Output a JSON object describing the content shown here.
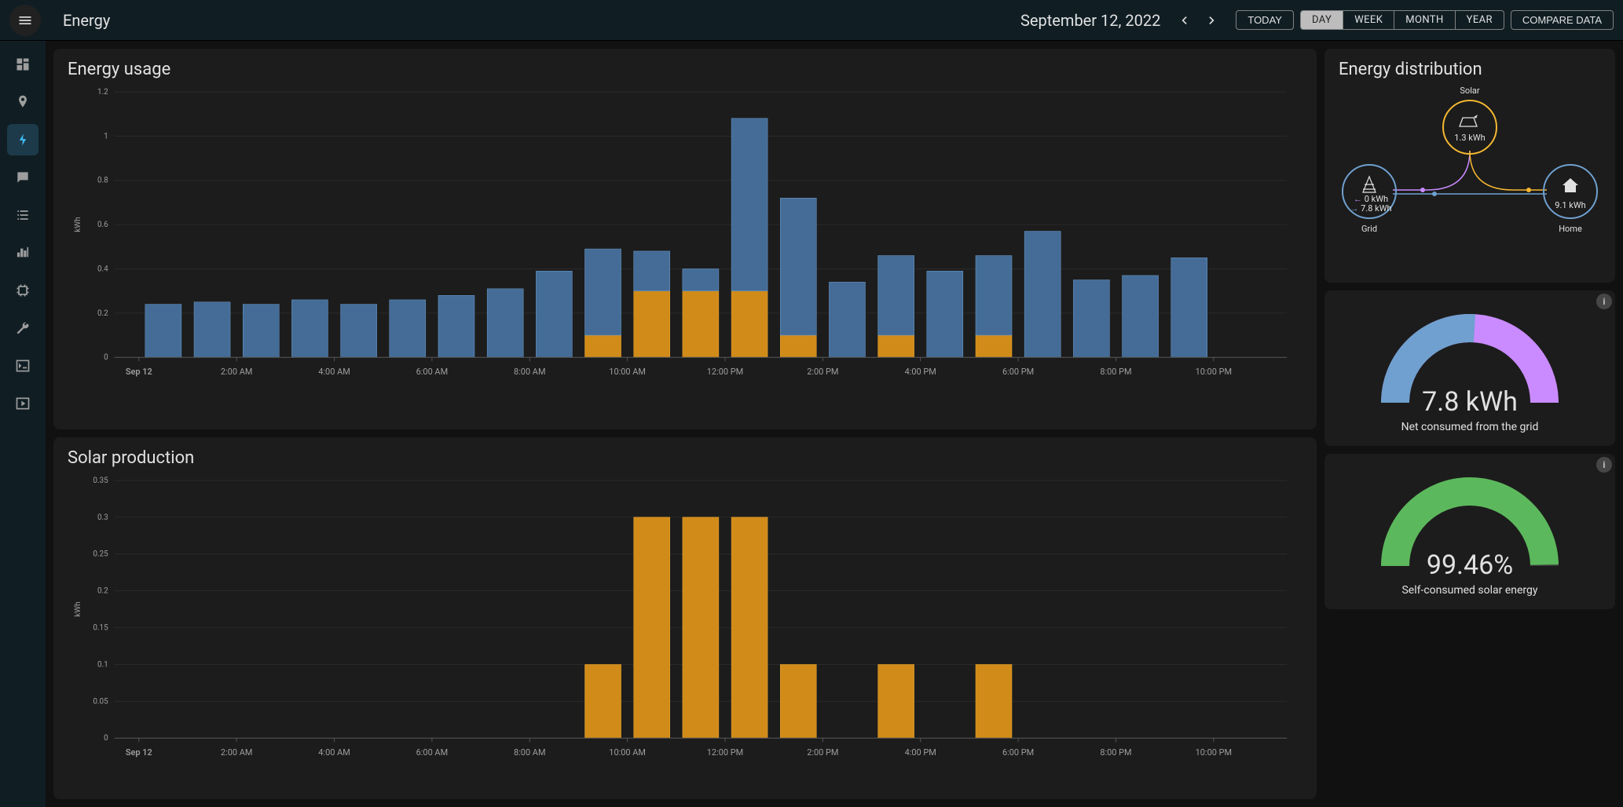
{
  "header": {
    "title": "Energy",
    "date": "September 12, 2022",
    "today_label": "TODAY",
    "ranges": [
      "DAY",
      "WEEK",
      "MONTH",
      "YEAR"
    ],
    "selected_range_index": 0,
    "compare_label": "COMPARE DATA"
  },
  "sidebar": {
    "items": [
      {
        "name": "overview",
        "icon": "dashboard"
      },
      {
        "name": "map",
        "icon": "map"
      },
      {
        "name": "energy",
        "icon": "bolt",
        "active": true
      },
      {
        "name": "logbook",
        "icon": "chat"
      },
      {
        "name": "list",
        "icon": "list"
      },
      {
        "name": "history",
        "icon": "bars"
      },
      {
        "name": "system",
        "icon": "chip"
      },
      {
        "name": "settings",
        "icon": "wrench"
      },
      {
        "name": "terminal",
        "icon": "terminal"
      },
      {
        "name": "media",
        "icon": "play"
      }
    ]
  },
  "panels": {
    "usage_title": "Energy usage",
    "solar_title": "Solar production",
    "dist_title": "Energy distribution",
    "net_gauge": {
      "value": "7.8 kWh",
      "caption": "Net consumed from the grid",
      "fraction": 0.52
    },
    "self_gauge": {
      "value": "99.46%",
      "caption": "Self-consumed solar energy",
      "fraction": 0.9946
    }
  },
  "distribution": {
    "solar": {
      "label": "Solar",
      "value": "1.3 kWh"
    },
    "grid": {
      "label": "Grid",
      "out": "0 kWh",
      "in": "7.8 kWh"
    },
    "home": {
      "label": "Home",
      "value": "9.1 kWh"
    }
  },
  "chart_data": [
    {
      "id": "usage",
      "type": "bar",
      "stacked": true,
      "ylabel": "kWh",
      "ylim": [
        0,
        1.2
      ],
      "yticks": [
        0,
        0.2,
        0.4,
        0.6,
        0.8,
        1,
        1.2
      ],
      "x_tick_labels": [
        "Sep 12",
        "2:00 AM",
        "4:00 AM",
        "6:00 AM",
        "8:00 AM",
        "10:00 AM",
        "12:00 PM",
        "2:00 PM",
        "4:00 PM",
        "6:00 PM",
        "8:00 PM",
        "10:00 PM"
      ],
      "hours": [
        0,
        1,
        2,
        3,
        4,
        5,
        6,
        7,
        8,
        9,
        10,
        11,
        12,
        13,
        14,
        15,
        16,
        17,
        18,
        19,
        20,
        21
      ],
      "series": [
        {
          "name": "Solar",
          "color": "#d99b2c",
          "values": [
            0,
            0,
            0,
            0,
            0,
            0,
            0,
            0,
            0,
            0.1,
            0.3,
            0.3,
            0.3,
            0.1,
            0,
            0.1,
            0,
            0.1,
            0,
            0,
            0,
            0
          ]
        },
        {
          "name": "Grid",
          "color": "#5a86b3",
          "values": [
            0.24,
            0.25,
            0.24,
            0.26,
            0.24,
            0.26,
            0.28,
            0.31,
            0.39,
            0.39,
            0.18,
            0.1,
            0.78,
            0.62,
            0.34,
            0.36,
            0.39,
            0.36,
            0.57,
            0.35,
            0.37,
            0.45
          ]
        }
      ]
    },
    {
      "id": "solar",
      "type": "bar",
      "stacked": false,
      "ylabel": "kWh",
      "ylim": [
        0,
        0.35
      ],
      "yticks": [
        0,
        0.05,
        0.1,
        0.15,
        0.2,
        0.25,
        0.3,
        0.35
      ],
      "x_tick_labels": [
        "Sep 12",
        "2:00 AM",
        "4:00 AM",
        "6:00 AM",
        "8:00 AM",
        "10:00 AM",
        "12:00 PM",
        "2:00 PM",
        "4:00 PM",
        "6:00 PM",
        "8:00 PM",
        "10:00 PM"
      ],
      "hours": [
        0,
        1,
        2,
        3,
        4,
        5,
        6,
        7,
        8,
        9,
        10,
        11,
        12,
        13,
        14,
        15,
        16,
        17,
        18,
        19,
        20,
        21
      ],
      "series": [
        {
          "name": "Solar",
          "color": "#d99b2c",
          "values": [
            0,
            0,
            0,
            0,
            0,
            0,
            0,
            0,
            0,
            0.1,
            0.3,
            0.3,
            0.3,
            0.1,
            0,
            0.1,
            0,
            0.1,
            0,
            0,
            0,
            0
          ]
        }
      ]
    }
  ]
}
